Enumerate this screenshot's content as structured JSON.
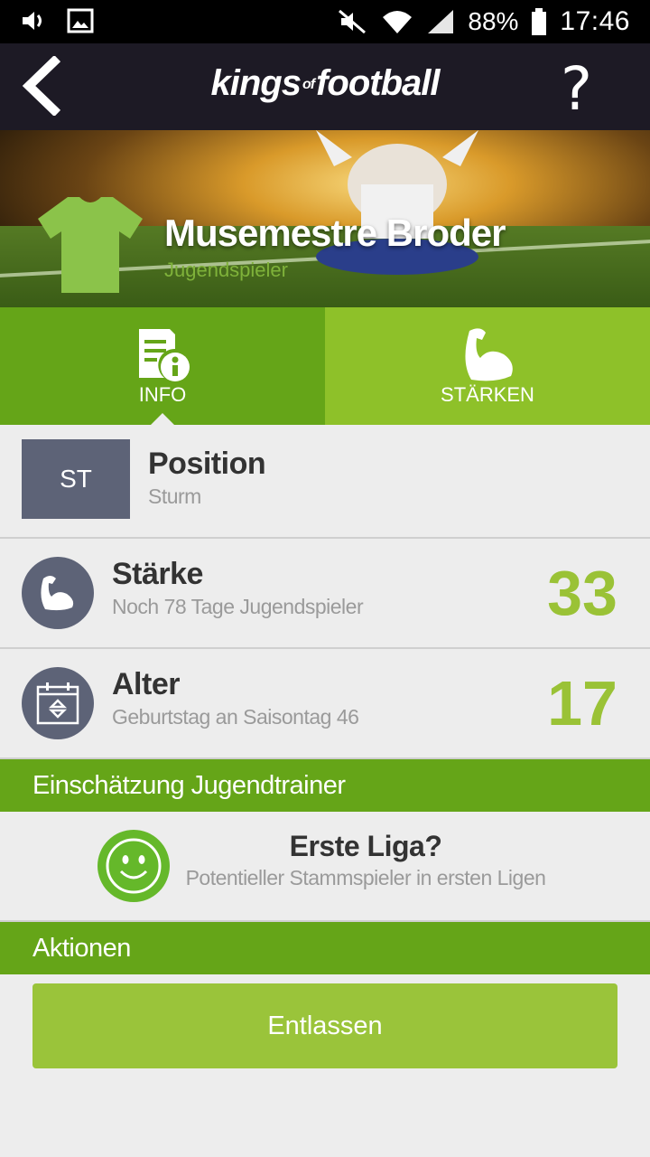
{
  "status_bar": {
    "battery_percent": "88%",
    "time": "17:46",
    "icons": [
      "volume-icon",
      "image-icon",
      "mute-icon",
      "wifi-icon",
      "signal-icon",
      "battery-icon"
    ]
  },
  "app_bar": {
    "logo_left": "kings",
    "logo_of": "of",
    "logo_right": "football",
    "help_label": "?"
  },
  "player": {
    "name": "Musemestre Broder",
    "role": "Jugendspieler"
  },
  "tabs": [
    {
      "label": "INFO",
      "icon": "info-document-icon",
      "active": true
    },
    {
      "label": "STÄRKEN",
      "icon": "biceps-icon",
      "active": false
    }
  ],
  "position": {
    "badge": "ST",
    "title": "Position",
    "value": "Sturm"
  },
  "strength": {
    "title": "Stärke",
    "subtitle": "Noch 78 Tage Jugendspieler",
    "value": "33"
  },
  "age": {
    "title": "Alter",
    "subtitle": "Geburtstag an Saisontag 46",
    "value": "17"
  },
  "assessment": {
    "header": "Einschätzung Jugendtrainer",
    "title": "Erste Liga?",
    "subtitle": "Potentieller Stammspieler in ersten Ligen"
  },
  "actions": {
    "header": "Aktionen",
    "dismiss_label": "Entlassen"
  },
  "colors": {
    "accent_green": "#65a518",
    "light_green": "#8ec129",
    "number_green": "#9ac236",
    "badge_gray": "#5d6377",
    "appbar": "#1d1a25"
  }
}
